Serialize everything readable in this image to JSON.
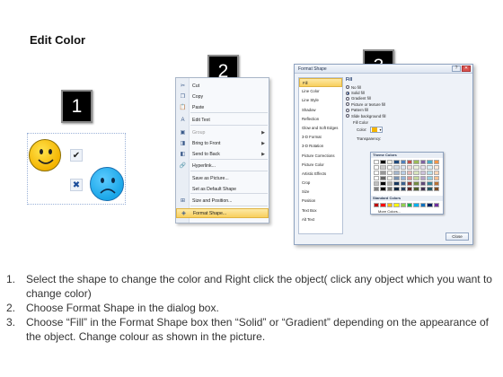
{
  "title": "Edit Color",
  "badges": {
    "step1": "1",
    "step2": "2",
    "step3": "3"
  },
  "context_menu": {
    "items": [
      {
        "icon": "scissors-icon",
        "glyph": "✂",
        "label": "Cut",
        "disabled": false
      },
      {
        "icon": "copy-icon",
        "glyph": "❐",
        "label": "Copy",
        "disabled": false
      },
      {
        "icon": "paste-icon",
        "glyph": "📋",
        "label": "Paste",
        "disabled": false
      },
      {
        "icon": "edit-text-icon",
        "glyph": "A",
        "label": "Edit Text",
        "disabled": false
      },
      {
        "icon": "group-icon",
        "glyph": "▣",
        "label": "Group",
        "disabled": true,
        "submenu": true
      },
      {
        "icon": "bring-front-icon",
        "glyph": "◨",
        "label": "Bring to Front",
        "disabled": false,
        "submenu": true
      },
      {
        "icon": "send-back-icon",
        "glyph": "◧",
        "label": "Send to Back",
        "disabled": false,
        "submenu": true
      },
      {
        "icon": "hyperlink-icon",
        "glyph": "🔗",
        "label": "Hyperlink...",
        "disabled": false
      },
      {
        "icon": "none",
        "glyph": "",
        "label": "Save as Picture...",
        "disabled": false
      },
      {
        "icon": "none",
        "glyph": "",
        "label": "Set as Default Shape",
        "disabled": false
      },
      {
        "icon": "size-position-icon",
        "glyph": "⊞",
        "label": "Size and Position...",
        "disabled": false
      },
      {
        "icon": "format-shape-icon",
        "glyph": "◈",
        "label": "Format Shape...",
        "disabled": false,
        "highlighted": true
      }
    ]
  },
  "dialog": {
    "title": "Format Shape",
    "categories": [
      "Fill",
      "Line Color",
      "Line Style",
      "Shadow",
      "Reflection",
      "Glow and Soft Edges",
      "3-D Format",
      "3-D Rotation",
      "Picture Corrections",
      "Picture Color",
      "Artistic Effects",
      "Crop",
      "Size",
      "Position",
      "Text Box",
      "Alt Text"
    ],
    "selected_category": "Fill",
    "panel_title": "Fill",
    "fill_options": [
      "No fill",
      "Solid fill",
      "Gradient fill",
      "Picture or texture fill",
      "Pattern fill",
      "Slide background fill"
    ],
    "selected_fill": "Solid fill",
    "fill_color_label": "Fill Color",
    "color_label": "Color:",
    "transparency_label": "Transparency:",
    "palette": {
      "theme_label": "Theme Colors",
      "standard_label": "Standard Colors",
      "more_label": "More Colors..."
    },
    "close_label": "Close"
  },
  "instructions": [
    {
      "num": "1.",
      "text": "Select the shape to change the color and Right click the object( click any object which you want to change color)"
    },
    {
      "num": "2.",
      "text": "Choose Format Shape in the dialog box."
    },
    {
      "num": "3.",
      "text": "Choose “Fill” in the Format Shape box then “Solid” or “Gradient” depending on the appearance of the object. Change colour as shown in the picture."
    }
  ],
  "colors": {
    "smiley_yellow": "#f4b400",
    "sad_blue": "#1aa6e8",
    "highlight": "#f8cf5d"
  }
}
